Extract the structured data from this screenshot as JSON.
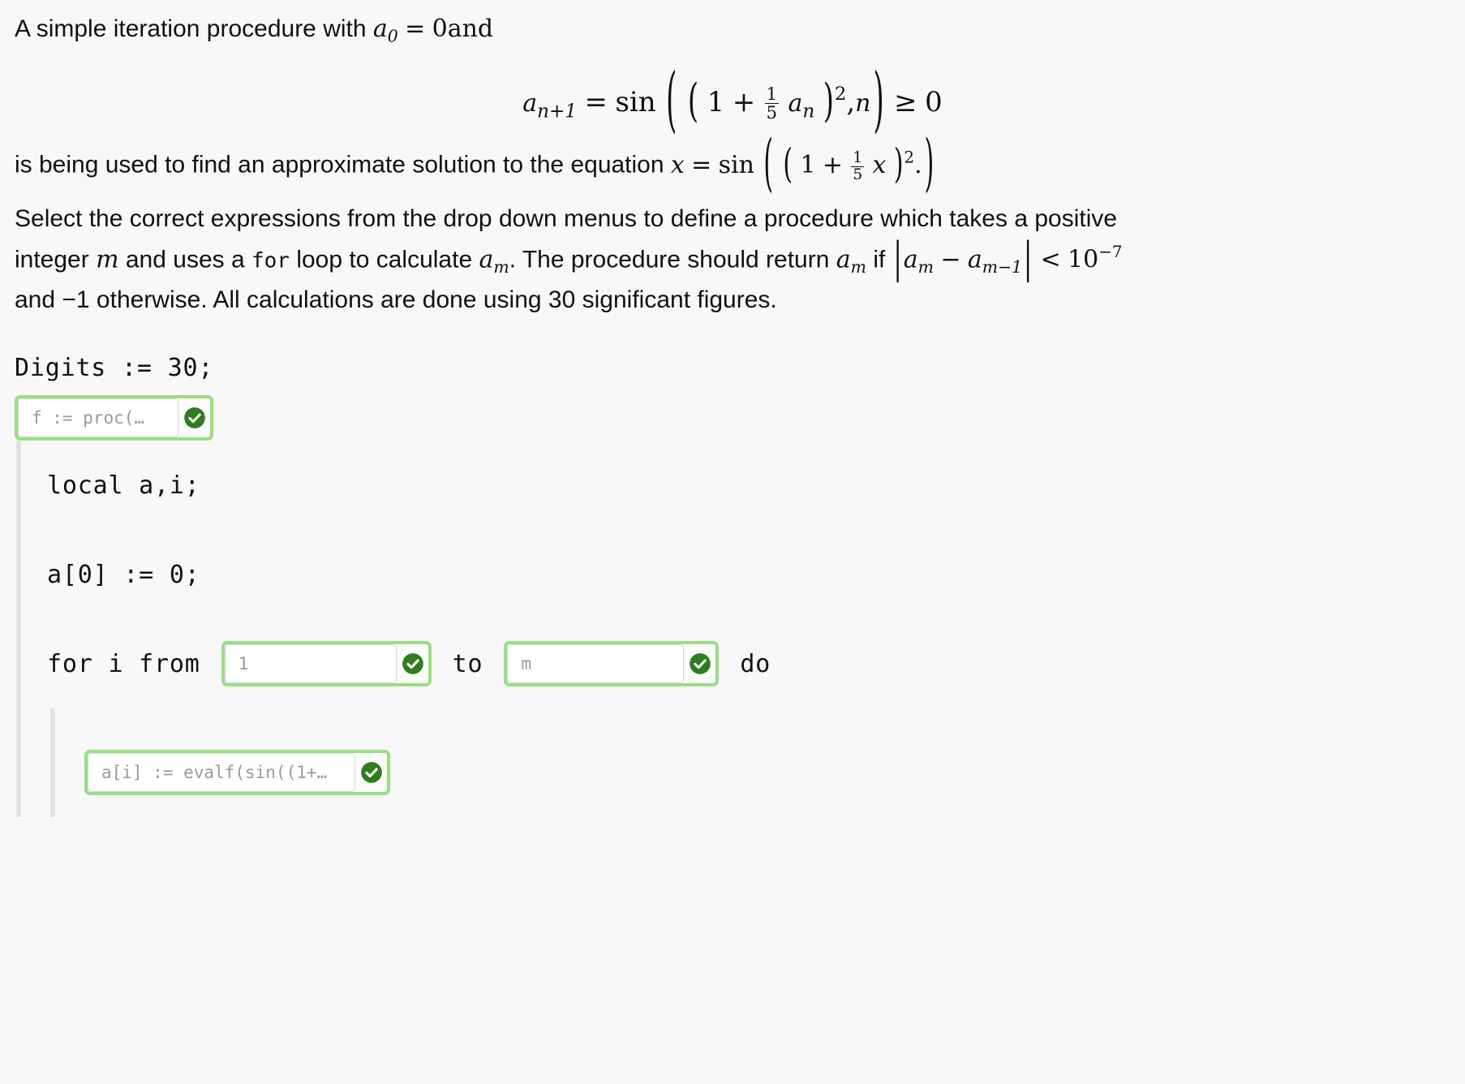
{
  "problem": {
    "intro_text": "A simple iteration procedure with",
    "intro_math": {
      "a": "a",
      "sub0": "0",
      "equals": "=",
      "zero_and": "0and"
    },
    "display_equation": {
      "lhs_var": "a",
      "lhs_sub": "n+1",
      "equals": "=",
      "func": "sin",
      "open_outer": "(",
      "open_inner": "(",
      "one": "1",
      "plus": "+",
      "frac_num": "1",
      "frac_den": "5",
      "arg_var": "a",
      "arg_sub": "n",
      "close_inner": ")",
      "power": "2",
      "comma": ",",
      "index_var": "n",
      "close_outer": ")",
      "geq": "≥",
      "bound": "0"
    },
    "line2_text": "is being used to find an approximate solution to the equation",
    "line2_equation": {
      "lhs_var": "x",
      "equals": "=",
      "func": "sin",
      "open_outer": "(",
      "open_inner": "(",
      "one": "1",
      "plus": "+",
      "frac_num": "1",
      "frac_den": "5",
      "arg_var": "x",
      "close_inner": ")",
      "power": "2",
      "period": ".",
      "close_outer": ")"
    },
    "instruction_line1": "Select the correct expressions from the drop down menus to define a procedure which takes a positive",
    "instruction_line2": {
      "part_a": "integer",
      "var_m": "m",
      "part_b": "and uses a",
      "keyword_for": "for",
      "part_c": "loop to calculate",
      "a_m_var": "a",
      "a_m_sub": "m",
      "part_d": ". The procedure should return",
      "ret_var": "a",
      "ret_sub": "m",
      "part_e": "if",
      "abs_open": "|",
      "abs_a1": "a",
      "abs_sub1": "m",
      "minus": "−",
      "abs_a2": "a",
      "abs_sub2": "m−1",
      "abs_close": "|",
      "less_than": "<",
      "ten": "10",
      "exponent": "−7"
    },
    "instruction_line3": "and −1 otherwise. All calculations are done using 30 significant figures."
  },
  "code": {
    "line_digits": "Digits := 30;",
    "dropdown_proc": {
      "value": "f := proc(…",
      "status": "correct"
    },
    "line_local": "local a,i;",
    "line_init": "a[0] := 0;",
    "for_loop": {
      "keyword_for_i_from": "for i from",
      "dropdown_from": {
        "value": "1",
        "status": "correct"
      },
      "keyword_to": "to",
      "dropdown_to": {
        "value": "m",
        "status": "correct"
      },
      "keyword_do": "do"
    },
    "dropdown_body": {
      "value": "a[i] := evalf(sin((1+…",
      "status": "correct"
    }
  },
  "colors": {
    "background": "#f8f8f8",
    "text": "#111111",
    "dropdown_border_valid": "#97e081",
    "check_badge": "#2e7d1e",
    "indent_rail": "#e2e2e2",
    "placeholder_text": "#9a9a9a"
  },
  "icons": {
    "check_circle": "check-circle-icon"
  }
}
